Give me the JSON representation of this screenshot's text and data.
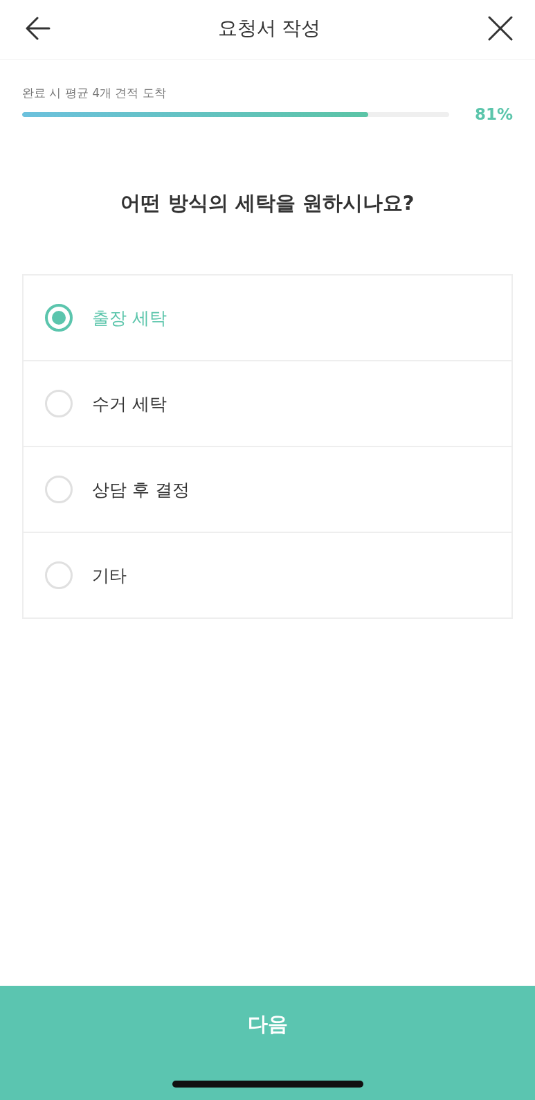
{
  "header": {
    "title": "요청서 작성"
  },
  "progress": {
    "label": "완료 시 평균 4개 견적 도착",
    "level": 0.81,
    "reading": "81%"
  },
  "question": "어떤 방식의 세탁을 원하시나요?",
  "options": [
    {
      "label": "출장 세탁",
      "selected": true
    },
    {
      "label": "수거 세탁",
      "selected": false
    },
    {
      "label": "상담 후 결정",
      "selected": false
    },
    {
      "label": "기타",
      "selected": false
    }
  ],
  "next_button": {
    "label": "다음"
  }
}
